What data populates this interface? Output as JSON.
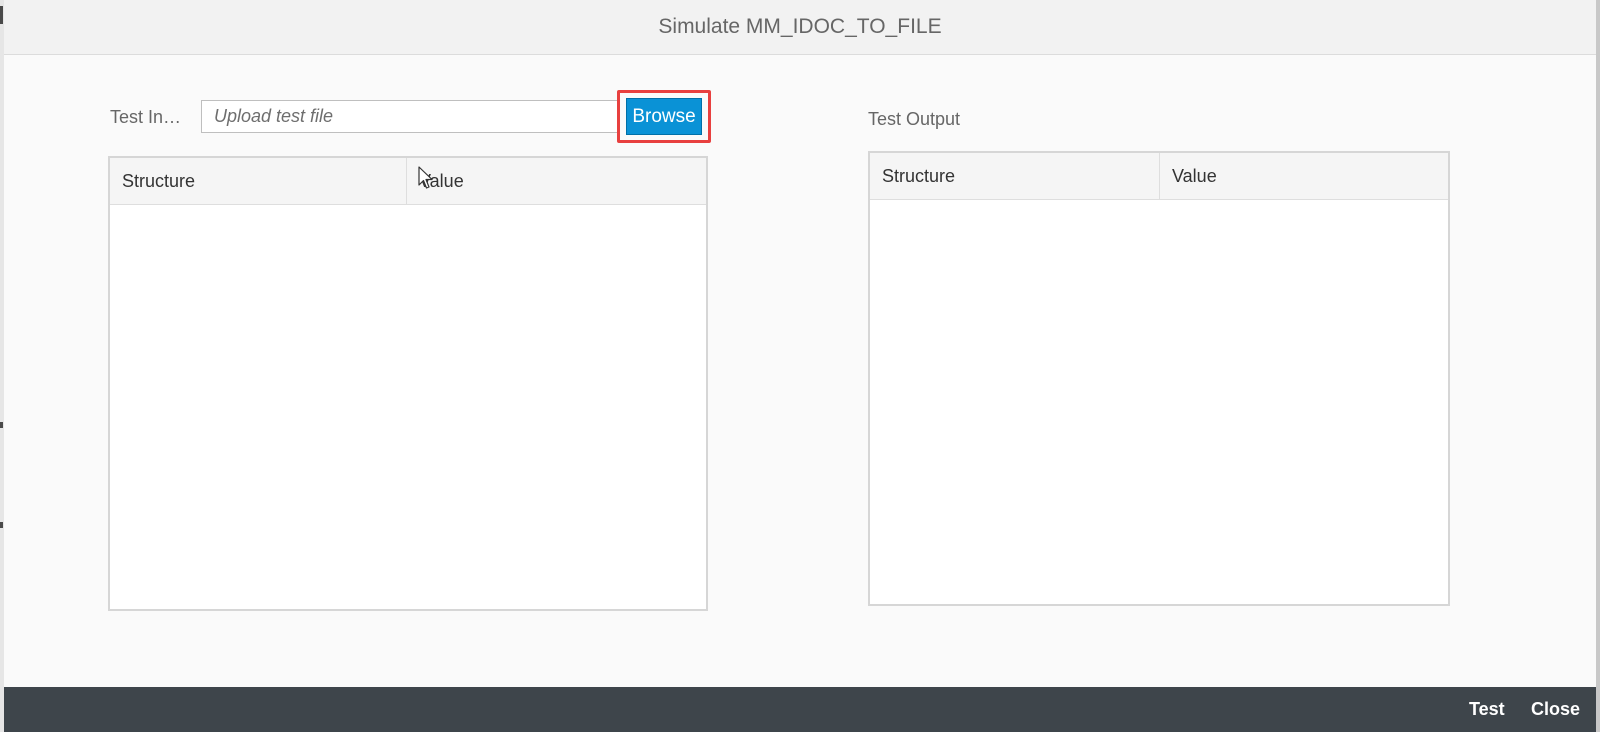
{
  "dialog": {
    "title": "Simulate MM_IDOC_TO_FILE"
  },
  "test_input": {
    "label": "Test In…",
    "file_placeholder": "Upload test file",
    "file_value": "",
    "browse_label": "Browse",
    "table": {
      "columns": [
        "Structure",
        "Value"
      ],
      "rows": []
    }
  },
  "test_output": {
    "label": "Test Output",
    "table": {
      "columns": [
        "Structure",
        "Value"
      ],
      "rows": []
    }
  },
  "footer": {
    "test_label": "Test",
    "close_label": "Close"
  },
  "colors": {
    "accent": "#0a92d6",
    "highlight": "#e8403f",
    "footer_bg": "#3e454b"
  }
}
